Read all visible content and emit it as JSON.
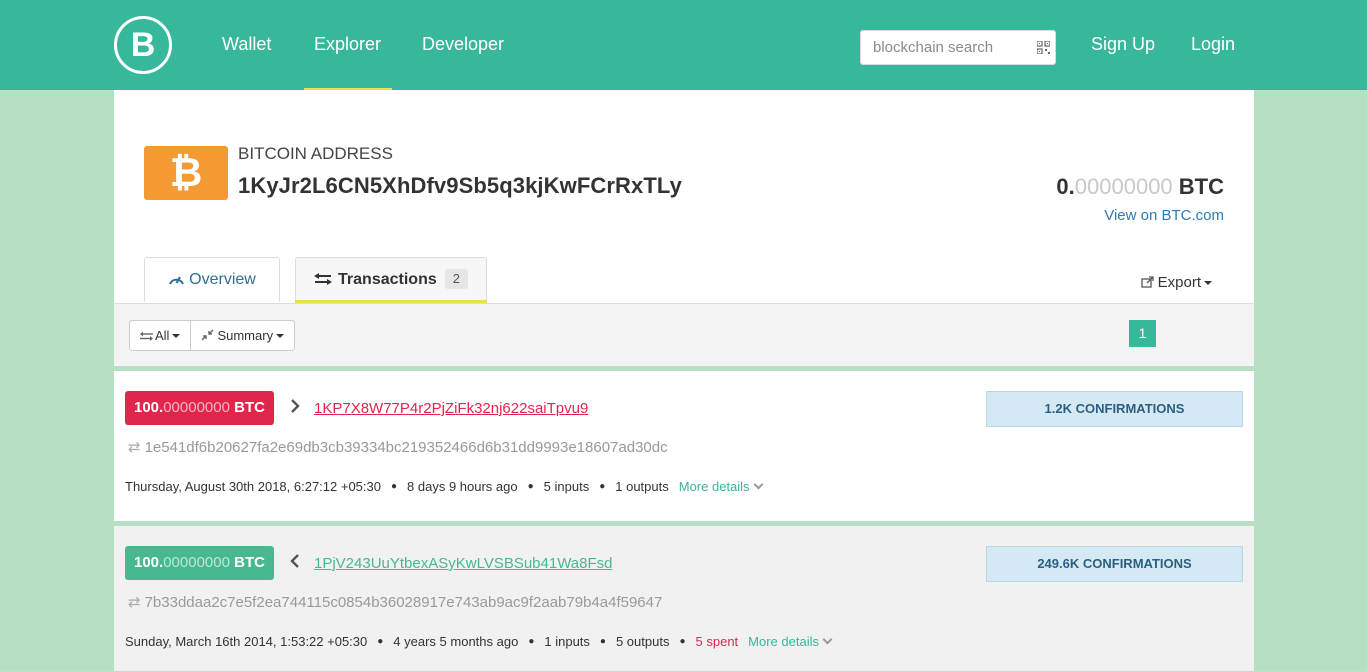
{
  "header": {
    "logo_text": "B",
    "nav": [
      "Wallet",
      "Explorer",
      "Developer"
    ],
    "search_placeholder": "blockchain search",
    "signup": "Sign Up",
    "login": "Login"
  },
  "address": {
    "coin_symbol": "₿",
    "label": "BITCOIN ADDRESS",
    "value": "1KyJr2L6CN5XhDfv9Sb5q3kjKwFCrRxTLy",
    "balance_int": "0.",
    "balance_dec": "00000000",
    "balance_unit": " BTC",
    "external_link": "View on BTC.com"
  },
  "tabs": {
    "overview": "Overview",
    "transactions": "Transactions",
    "transactions_count": "2",
    "export": "Export"
  },
  "toolbar": {
    "filter": "All",
    "view": "Summary",
    "page": "1"
  },
  "transactions": [
    {
      "amount_int": "100.",
      "amount_dec": "00000000",
      "amount_unit": " BTC",
      "direction_icon": "chevron-right-icon",
      "counterparty": "1KP7X8W77P4r2PjZiFk32nj622saiTpvu9",
      "confirmations": "1.2K CONFIRMATIONS",
      "hash": "1e541df6b20627fa2e69db3cb39334bc219352466d6b31dd9993e18607ad30dc",
      "date": "Thursday, August 30th 2018, 6:27:12 +05:30",
      "age": "8 days 9 hours ago",
      "inputs": "5 inputs",
      "outputs": "1 outputs",
      "spent": "",
      "more": "More details"
    },
    {
      "amount_int": "100.",
      "amount_dec": "00000000",
      "amount_unit": " BTC",
      "direction_icon": "chevron-left-icon",
      "counterparty": "1PjV243UuYtbexASyKwLVSBSub41Wa8Fsd",
      "confirmations": "249.6K CONFIRMATIONS",
      "hash": "7b33ddaa2c7e5f2ea744115c0854b36028917e743ab9ac9f2aab79b4a4f59647",
      "date": "Sunday, March 16th 2014, 1:53:22 +05:30",
      "age": "4 years 5 months ago",
      "inputs": "1 inputs",
      "outputs": "5 outputs",
      "spent": "5 spent",
      "more": "More details"
    }
  ],
  "colors": {
    "brand": "#38b89b",
    "background": "#b6dfc4",
    "outgoing": "#e0264b",
    "incoming": "#47b88f",
    "accent_underline": "#e9e14a",
    "coin": "#f39a32"
  }
}
